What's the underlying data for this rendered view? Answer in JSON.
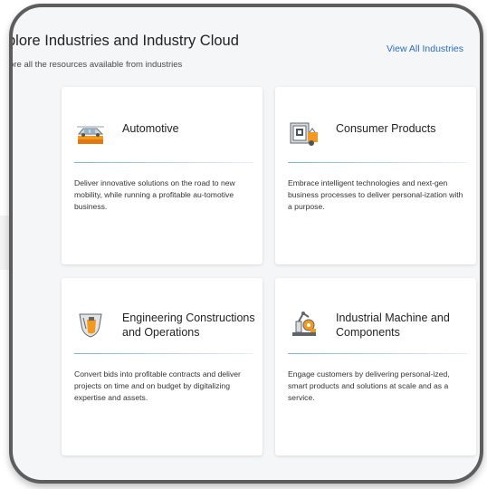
{
  "header": {
    "title": "plore Industries and Industry Cloud",
    "subtitle": "lore all the resources available from industries",
    "view_all_label": "View All Industries"
  },
  "cards": [
    {
      "title": "Automotive",
      "description": "Deliver innovative solutions on the road to new mobility, while running a profitable au-tomotive business.",
      "icon": "car-icon"
    },
    {
      "title": "Consumer Products",
      "description": "Embrace intelligent technologies and next-gen business processes to deliver personal-ization with a purpose.",
      "icon": "consumer-products-icon"
    },
    {
      "title": "Engineering Constructions and Operations",
      "description": "Convert bids into profitable contracts and deliver projects on time and on budget by digitalizing expertise and assets.",
      "icon": "construction-icon"
    },
    {
      "title": "Industrial Machine and Components",
      "description": "Engage customers by delivering personal-ized, smart products and solutions at scale and as a service.",
      "icon": "industrial-machine-icon"
    }
  ],
  "colors": {
    "link": "#2c6cc4",
    "accent_orange": "#f39a1e",
    "divider": "#7ab8d3",
    "frame_border": "#5d5d5d"
  }
}
